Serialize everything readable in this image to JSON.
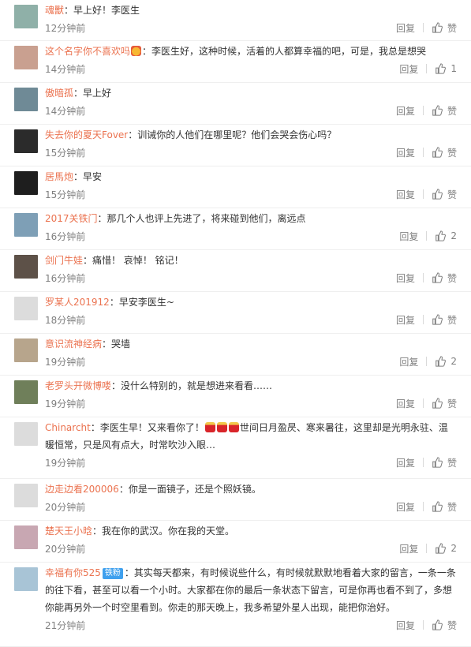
{
  "ui": {
    "reply_label": "回复",
    "like_default": "赞"
  },
  "comments": [
    {
      "user": "魂獸",
      "text": "：早上好！李医生",
      "time": "12分钟前",
      "likes": "赞",
      "avatar_color": "#8fb0a8",
      "emoji": ""
    },
    {
      "user": "这个名字你不喜欢吗",
      "text": "：李医生好，这种时候，活着的人都算幸福的吧，可是，我总是想哭",
      "time": "14分钟前",
      "likes": "1",
      "avatar_color": "#c9a090",
      "emoji": "happy-emoji"
    },
    {
      "user": "傲暗孤",
      "text": "：早上好",
      "time": "14分钟前",
      "likes": "赞",
      "avatar_color": "#6f8a96",
      "emoji": ""
    },
    {
      "user": "失去你的夏天Fover",
      "text": "：训诫你的人他们在哪里呢？他们会哭会伤心吗？",
      "time": "15分钟前",
      "likes": "赞",
      "avatar_color": "#2b2b2b",
      "emoji": ""
    },
    {
      "user": "居馬炮",
      "text": "：早安",
      "time": "15分钟前",
      "likes": "赞",
      "avatar_color": "#1e1e1e",
      "emoji": ""
    },
    {
      "user": "2017关铁门",
      "text": "：那几个人也评上先进了，将来碰到他们，离远点",
      "time": "16分钟前",
      "likes": "2",
      "avatar_color": "#7e9fb6",
      "emoji": ""
    },
    {
      "user": "剑门牛娃",
      "text": "：痛惜！ 哀悼！ 铭记！",
      "time": "16分钟前",
      "likes": "赞",
      "avatar_color": "#5d5148",
      "emoji": ""
    },
    {
      "user": "罗某人201912",
      "text": "：早安李医生~",
      "time": "18分钟前",
      "likes": "赞",
      "avatar_color": "#dcdcdc",
      "emoji": ""
    },
    {
      "user": "意识流神经病",
      "text": "：哭墙",
      "time": "19分钟前",
      "likes": "2",
      "avatar_color": "#b7a58c",
      "emoji": ""
    },
    {
      "user": "老罗头开微博喽",
      "text": "：没什么特别的，就是想进来看看……",
      "time": "19分钟前",
      "likes": "赞",
      "avatar_color": "#6f7f5a",
      "emoji": ""
    },
    {
      "user": "Chinarcht",
      "text": "：李医生早！又来看你了！",
      "text2": "世间日月盈昃、寒来暑往，这里却是光明永驻、温暖恒常，只是风有点大，时常吹沙入眼…",
      "time": "19分钟前",
      "likes": "赞",
      "avatar_color": "#dcdcdc",
      "emoji": "candle-emoji"
    },
    {
      "user": "边走边看200006",
      "text": "：你是一面镜子，还是个照妖镜。",
      "time": "20分钟前",
      "likes": "赞",
      "avatar_color": "#dcdcdc",
      "emoji": ""
    },
    {
      "user": "楚天王小晗",
      "text": "：我在你的武汉。你在我的天堂。",
      "time": "20分钟前",
      "likes": "2",
      "avatar_color": "#c8a7b2",
      "emoji": ""
    },
    {
      "user": "幸福有你525",
      "badge": "铁粉",
      "text": "：其实每天都来，有时候说些什么，有时候就默默地看着大家的留言，一条一条的往下看，甚至可以看一个小时。大家都在你的最后一条状态下留言，可是你再也看不到了，多想你能再另外一个时空里看到。你走的那天晚上，我多希望外星人出现，能把你治好。",
      "time": "21分钟前",
      "likes": "赞",
      "avatar_color": "#a8c4d6",
      "emoji": ""
    }
  ]
}
